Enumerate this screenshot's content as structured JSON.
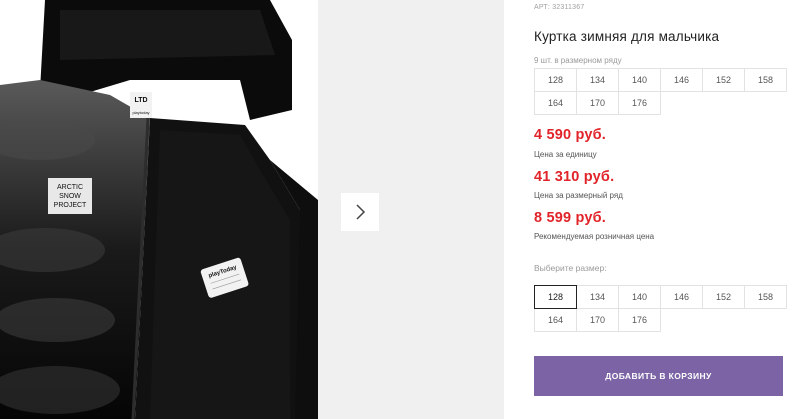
{
  "product": {
    "sku_label": "АРТ: 32311367",
    "title": "Куртка зимняя для мальчика",
    "size_row_note": "9 шт. в размерном ряду",
    "size_row": [
      "128",
      "134",
      "140",
      "146",
      "152",
      "158",
      "164",
      "170",
      "176"
    ]
  },
  "photo": {
    "badge_patch": [
      "ARCTIC",
      "SNOW",
      "PROJECT"
    ],
    "inner_tag": "playToday",
    "collar_label_top": "LTD",
    "collar_label_bottom": "playtoday"
  },
  "prices": [
    {
      "amount": "4 590 руб.",
      "caption": "Цена за единицу"
    },
    {
      "amount": "41 310 руб.",
      "caption": "Цена за размерный ряд"
    },
    {
      "amount": "8 599 руб.",
      "caption": "Рекомендуемая розничная цена"
    }
  ],
  "size_select": {
    "label": "Выберите размер:",
    "options": [
      "128",
      "134",
      "140",
      "146",
      "152",
      "158",
      "164",
      "170",
      "176"
    ],
    "selected": "128"
  },
  "actions": {
    "add_to_cart": "ДОБАВИТЬ В КОРЗИНУ"
  },
  "colors": {
    "price": "#e1242a",
    "button": "#7b63a6"
  }
}
